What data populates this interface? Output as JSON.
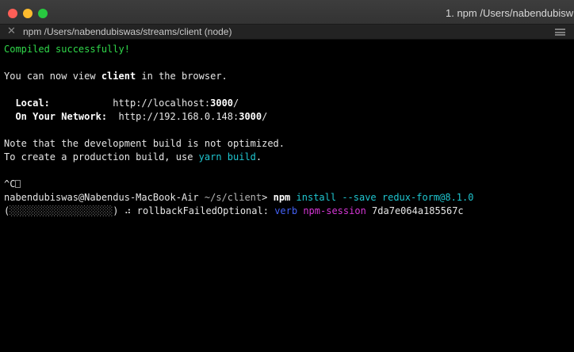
{
  "window": {
    "title": "1. npm  /Users/nabendubisw"
  },
  "tab": {
    "close_glyph": "✕",
    "label": "npm  /Users/nabendubiswas/streams/client (node)"
  },
  "colors": {
    "success_green": "#30d84a",
    "cyan": "#1fc5cf",
    "verb_blue": "#4361f5",
    "session_magenta": "#d636d6"
  },
  "terminal": {
    "compiled": "Compiled successfully!",
    "view_prefix": "You can now view ",
    "view_app": "client",
    "view_suffix": " in the browser.",
    "local_label": "Local:",
    "local_url_prefix": "http://localhost:",
    "local_port": "3000",
    "local_url_suffix": "/",
    "network_label": "On Your Network:",
    "network_url_prefix": "http://192.168.0.148:",
    "network_port": "3000",
    "network_url_suffix": "/",
    "note": "Note that the development build is not optimized.",
    "build_prefix": "To create a production build, use ",
    "build_cmd": "yarn build",
    "build_suffix": ".",
    "interrupt": "^C",
    "prompt_user": "nabendubiswas@Nabendus-MacBook-Air",
    "prompt_path": "~/s/client",
    "prompt_symbol": ">",
    "cmd_npm": "npm",
    "cmd_args": "install --save redux-form@8.1.0",
    "progress_open": "(",
    "progress_track": "░░░░░░░░░░░░░░░░░░",
    "progress_close": ")",
    "spinner": "⠴",
    "rollback_label": "rollbackFailedOptional:",
    "verb": "verb",
    "session": "npm-session",
    "session_id": "7da7e064a185567c"
  }
}
